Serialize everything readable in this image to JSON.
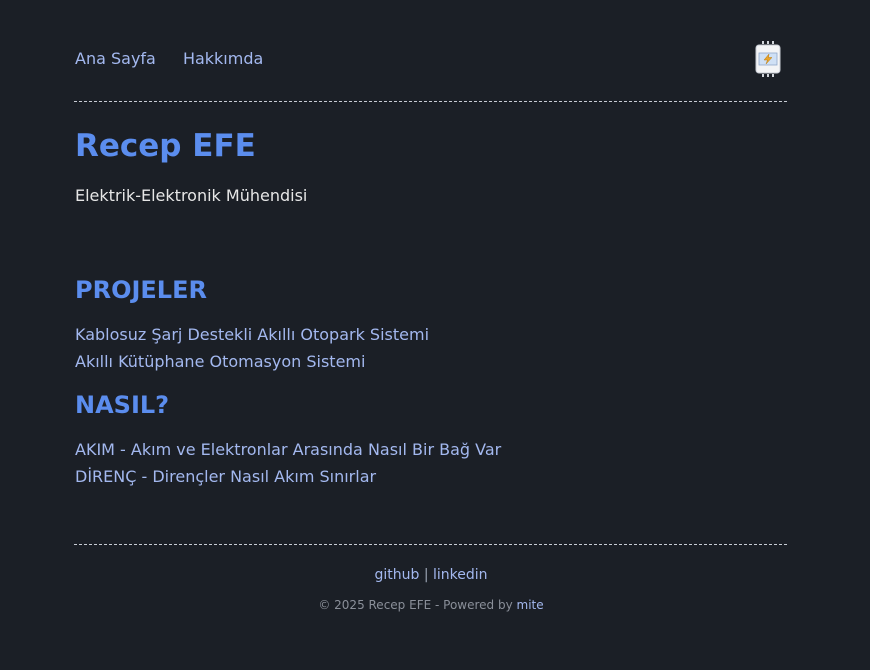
{
  "nav": {
    "home": "Ana Sayfa",
    "about": "Hakkımda",
    "logo_icon": "chip-lightning-icon"
  },
  "header": {
    "title": "Recep EFE",
    "subtitle": "Elektrik-Elektronik Mühendisi"
  },
  "sections": {
    "projects": {
      "title": "PROJELER",
      "items": [
        "Kablosuz Şarj Destekli Akıllı Otopark Sistemi",
        "Akıllı Kütüphane Otomasyon Sistemi"
      ]
    },
    "how": {
      "title": "NASIL?",
      "items": [
        "AKIM - Akım ve Elektronlar Arasında Nasıl Bir Bağ Var",
        "DİRENÇ - Dirençler Nasıl Akım Sınırlar"
      ]
    }
  },
  "footer": {
    "github": "github",
    "separator": "|",
    "linkedin": "linkedin",
    "copyright": "© 2025 Recep EFE - Powered by",
    "powered_link": "mite"
  },
  "colors": {
    "background": "#1b1f26",
    "heading": "#5b8dee",
    "link": "#a3b8ef"
  }
}
